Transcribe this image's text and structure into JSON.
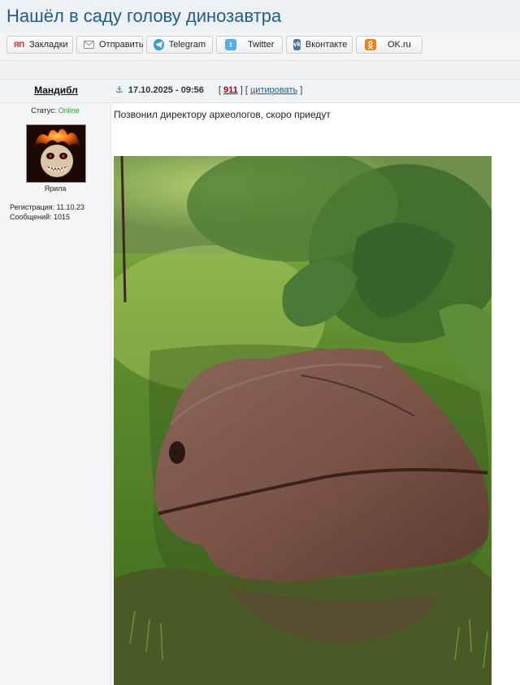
{
  "page": {
    "title": "Нашёл в саду голову динозавтра"
  },
  "share_buttons": [
    {
      "label": "Закладки",
      "icon": "yandex-bookmarks-icon",
      "icon_text": "ЯП",
      "color": "#cc1f1f"
    },
    {
      "label": "Отправить",
      "icon": "envelope-icon",
      "icon_text": "",
      "color": "#8a8f94"
    },
    {
      "label": "Telegram",
      "icon": "telegram-icon",
      "icon_text": "",
      "color": "#2a9fd8"
    },
    {
      "label": "Twitter",
      "icon": "twitter-icon",
      "icon_text": "",
      "color": "#55acee"
    },
    {
      "label": "Вконтакте",
      "icon": "vk-icon",
      "icon_text": "vk",
      "color": "#4a76a8"
    },
    {
      "label": "OK.ru",
      "icon": "odnoklassniki-icon",
      "icon_text": "ok",
      "color": "#ee8208"
    }
  ],
  "post": {
    "author": "Мандибл",
    "status_label": "Статус:",
    "status_value": "Online",
    "avatar_caption": "Ярила",
    "registration_label": "Регистрация:",
    "registration_date": "11.10.23",
    "messages_label": "Сообщений:",
    "messages_count": "1015",
    "datetime": "17.10.2025 - 09:56",
    "rating": "911",
    "quote_label": "цитировать",
    "text": "Позвонил директору археологов, скоро приедут",
    "image_description_icon": "photo-boulder-in-garden"
  },
  "colors": {
    "title": "#1f5d8c",
    "online": "#2a9a2a",
    "rating": "#b00000"
  }
}
